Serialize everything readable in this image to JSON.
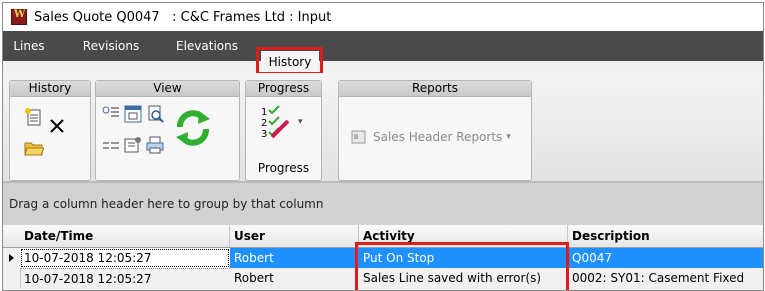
{
  "window": {
    "title": "Sales Quote Q0047   : C&C Frames Ltd : Input"
  },
  "menu": {
    "tabs": [
      {
        "label": "Lines"
      },
      {
        "label": "Revisions"
      },
      {
        "label": "Elevations"
      },
      {
        "label": "History"
      }
    ],
    "active_tab": "History"
  },
  "ribbon": {
    "groups": [
      {
        "label": "History"
      },
      {
        "label": "View"
      },
      {
        "label": "Progress"
      },
      {
        "label": "Reports"
      }
    ],
    "progress_button_label": "Progress",
    "reports_button_label": "Sales Header Reports",
    "icons": {
      "history": [
        "new-note-icon",
        "delete-icon",
        "open-folder-icon"
      ],
      "view": [
        "add-column-icon",
        "calendar-icon",
        "print-preview-icon",
        "refresh-icon",
        "list-icon",
        "properties-icon",
        "print-icon"
      ],
      "progress": "checklist-icon",
      "reports": "report-icon"
    }
  },
  "grid": {
    "group_panel_text": "Drag a column header here to group by that column",
    "columns": [
      "Date/Time",
      "User",
      "Activity",
      "Description"
    ],
    "rows": [
      {
        "datetime": "10-07-2018 12:05:27",
        "user": "Robert",
        "activity": "Put On Stop",
        "description": "Q0047",
        "selected": true
      },
      {
        "datetime": "10-07-2018 12:05:27",
        "user": "Robert",
        "activity": "Sales Line saved with error(s)",
        "description": "0002: SY01: Casement Fixed",
        "selected": false
      }
    ]
  },
  "colors": {
    "selection": "#1e90ff",
    "annotation": "#e01b1b",
    "tabstrip": "#4a4a4a"
  }
}
